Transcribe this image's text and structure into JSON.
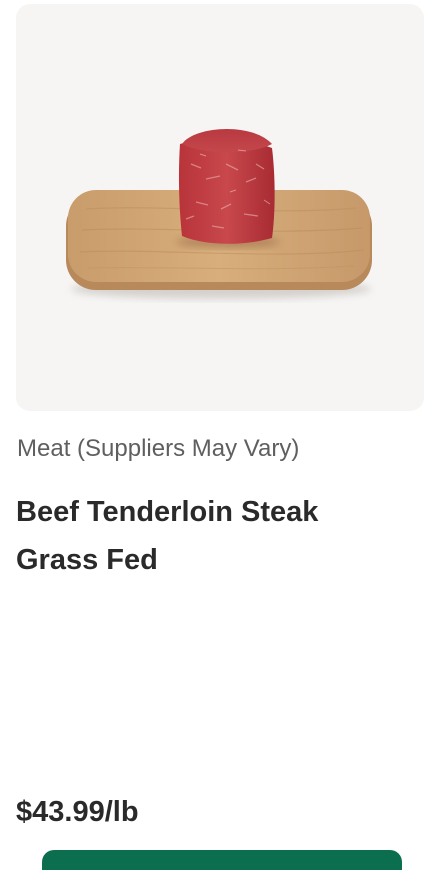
{
  "product": {
    "category": "Meat (Suppliers May Vary)",
    "title_line1": "Beef Tenderloin Steak",
    "title_line2": "Grass Fed",
    "price": "$43.99/lb",
    "image_alt": "Beef tenderloin steak on a wooden cutting board"
  },
  "colors": {
    "image_background": "#f6f5f4",
    "button": "#0b6e4f",
    "text_primary": "#2a2a2a",
    "text_secondary": "#5f5f5f"
  }
}
